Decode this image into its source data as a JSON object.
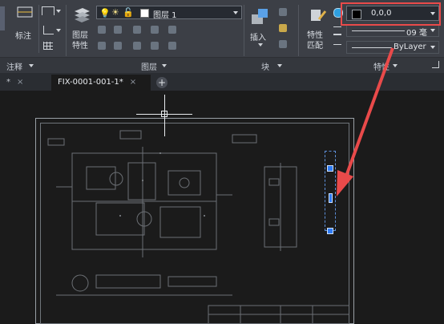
{
  "ribbon": {
    "annotation_group": {
      "title": "注释",
      "label_biaozhu": "标注"
    },
    "layers_group": {
      "title": "图层",
      "layer_properties_label": "图层\n特性",
      "layer_selector_value": "图层 1"
    },
    "block_group": {
      "title": "块",
      "insert_label": "插入"
    },
    "properties_group": {
      "title": "特性",
      "match_label": "特性\n匹配",
      "color_value": "0,0,0",
      "lineweight_value": "09 毫",
      "linetype_value": "ByLayer"
    }
  },
  "tabs": [
    {
      "label": "*"
    },
    {
      "label": "FIX-0001-001-1*"
    }
  ],
  "colors": {
    "ribbon_bg": "#3c3f46",
    "canvas_bg": "#1b1b1b",
    "highlight": "#e94a4a",
    "grip": "#2f7cf6"
  }
}
